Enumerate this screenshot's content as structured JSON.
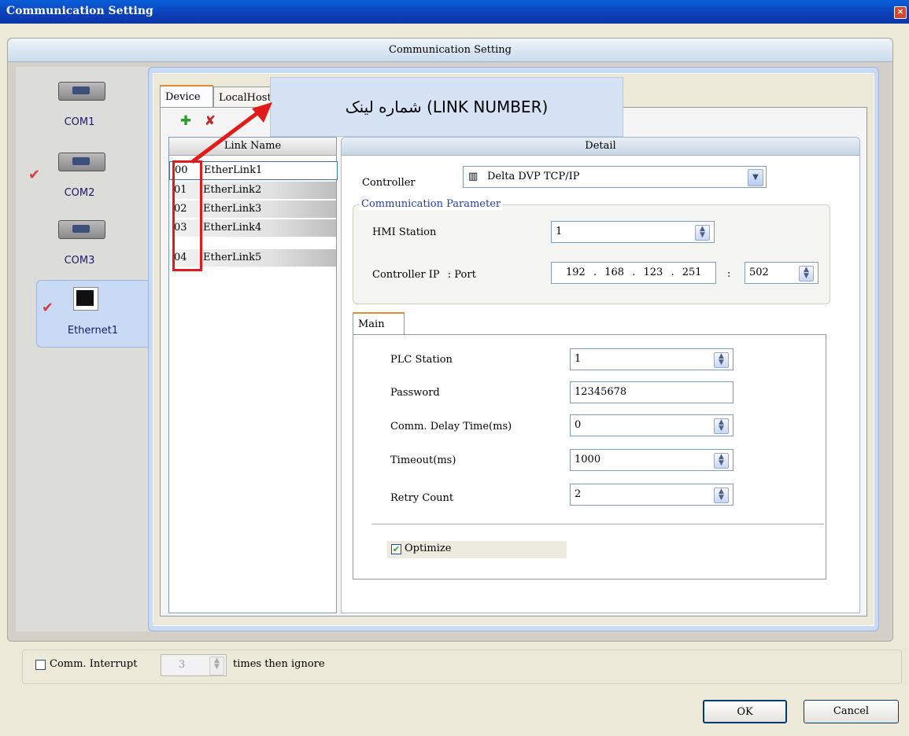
{
  "window": {
    "title": "Communication Setting",
    "close_icon": "close-icon"
  },
  "header": {
    "title": "Communication Setting"
  },
  "ports": [
    {
      "label": "COM1",
      "checked": false
    },
    {
      "label": "COM2",
      "checked": true
    },
    {
      "label": "COM3",
      "checked": false
    },
    {
      "label": "Ethernet1",
      "checked": true
    }
  ],
  "tabs": {
    "device": "Device",
    "localhost": "LocalHost"
  },
  "toolbar": {
    "add_icon": "add-link-icon",
    "delete_icon": "delete-link-icon"
  },
  "link_list": {
    "header": "Link Name",
    "rows": [
      {
        "num": "00",
        "name": "EtherLink1"
      },
      {
        "num": "01",
        "name": "EtherLink2"
      },
      {
        "num": "02",
        "name": "EtherLink3"
      },
      {
        "num": "03",
        "name": "EtherLink4"
      },
      {
        "num": "04",
        "name": "EtherLink5"
      }
    ]
  },
  "detail": {
    "header": "Detail",
    "controller_label": "Controller",
    "controller_value": "Delta DVP TCP/IP",
    "comm_param_title": "Communication Parameter",
    "hmi_station_label": "HMI Station",
    "hmi_station_value": "1",
    "controller_ip_label": "Controller IP",
    "port_label": ": Port",
    "ip": {
      "o1": "192",
      "o2": "168",
      "o3": "123",
      "o4": "251"
    },
    "ip_sep": ":",
    "port_value": "502",
    "main_tab": "Main",
    "plc_station_label": "PLC Station",
    "plc_station_value": "1",
    "password_label": "Password",
    "password_value": "12345678",
    "delay_label": "Comm. Delay Time(ms)",
    "delay_value": "0",
    "timeout_label": "Timeout(ms)",
    "timeout_value": "1000",
    "retry_label": "Retry Count",
    "retry_value": "2",
    "optimize_label": "Optimize",
    "optimize_checked": true
  },
  "bottom": {
    "comm_interrupt_label": "Comm. Interrupt",
    "interrupt_value": "3",
    "times_label": "times then ignore",
    "ok": "OK",
    "cancel": "Cancel"
  },
  "annotation": {
    "callout_text": "شماره لینک (LINK NUMBER)",
    "highlight_color": "#E21A1A"
  }
}
